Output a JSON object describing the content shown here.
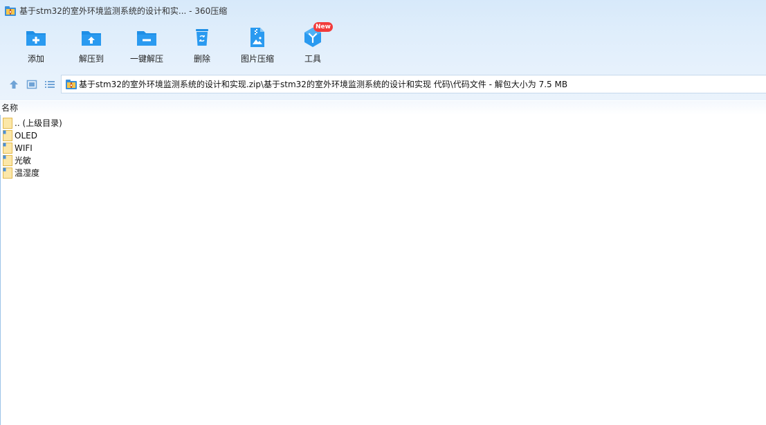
{
  "window": {
    "title": "基于stm32的室外环境监测系统的设计和实... - 360压缩"
  },
  "toolbar": {
    "buttons": [
      {
        "label": "添加",
        "icon": "folder-add-icon"
      },
      {
        "label": "解压到",
        "icon": "folder-extract-icon"
      },
      {
        "label": "一键解压",
        "icon": "folder-minus-icon"
      },
      {
        "label": "删除",
        "icon": "trash-icon"
      },
      {
        "label": "图片压缩",
        "icon": "image-compress-icon"
      },
      {
        "label": "工具",
        "icon": "tools-cube-icon"
      }
    ],
    "badge": "New"
  },
  "nav": {
    "path": "基于stm32的室外环境监测系统的设计和实现.zip\\基于stm32的室外环境监测系统的设计和实现 代码\\代码文件 - 解包大小为 7.5 MB"
  },
  "list": {
    "column_name": "名称",
    "items": [
      {
        "name": ".. (上级目录)",
        "type": "parent"
      },
      {
        "name": "OLED",
        "type": "folder"
      },
      {
        "name": "WIFI",
        "type": "folder"
      },
      {
        "name": "光敏",
        "type": "folder"
      },
      {
        "name": "温湿度",
        "type": "folder"
      }
    ]
  },
  "colors": {
    "accent": "#1e8fe6",
    "folder": "#f7d77c",
    "badge": "#f23b3b"
  }
}
